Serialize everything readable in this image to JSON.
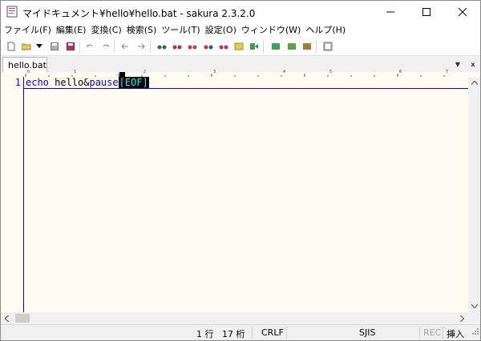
{
  "window": {
    "title": "マイドキュメント¥hello¥hello.bat - sakura 2.3.2.0"
  },
  "menu": [
    "ファイル(F)",
    "編集(E)",
    "変換(C)",
    "検索(S)",
    "ツール(T)",
    "設定(O)",
    "ウィンドウ(W)",
    "ヘルプ(H)"
  ],
  "tab": {
    "label": "hello.bat",
    "menu_glyph": "▼",
    "close_glyph": "x"
  },
  "ruler": {
    "marks": [
      "0",
      "1",
      "2",
      "3",
      "4",
      "5",
      "6",
      "7"
    ]
  },
  "editor": {
    "line_number": "1",
    "tokens": {
      "kw1": "echo",
      "plain": " hello&",
      "kw2": "pause",
      "eof": "[EOF]"
    }
  },
  "status": {
    "line": "1 行",
    "column": "17 桁",
    "eol": "CRLF",
    "encoding": "SJIS",
    "rec": "REC",
    "mode": "挿入"
  },
  "colors": {
    "editor_bg": "#fffbf0",
    "keyword": "#0000ff",
    "eof_bg": "#000000",
    "eof_fg": "#00ffff"
  }
}
